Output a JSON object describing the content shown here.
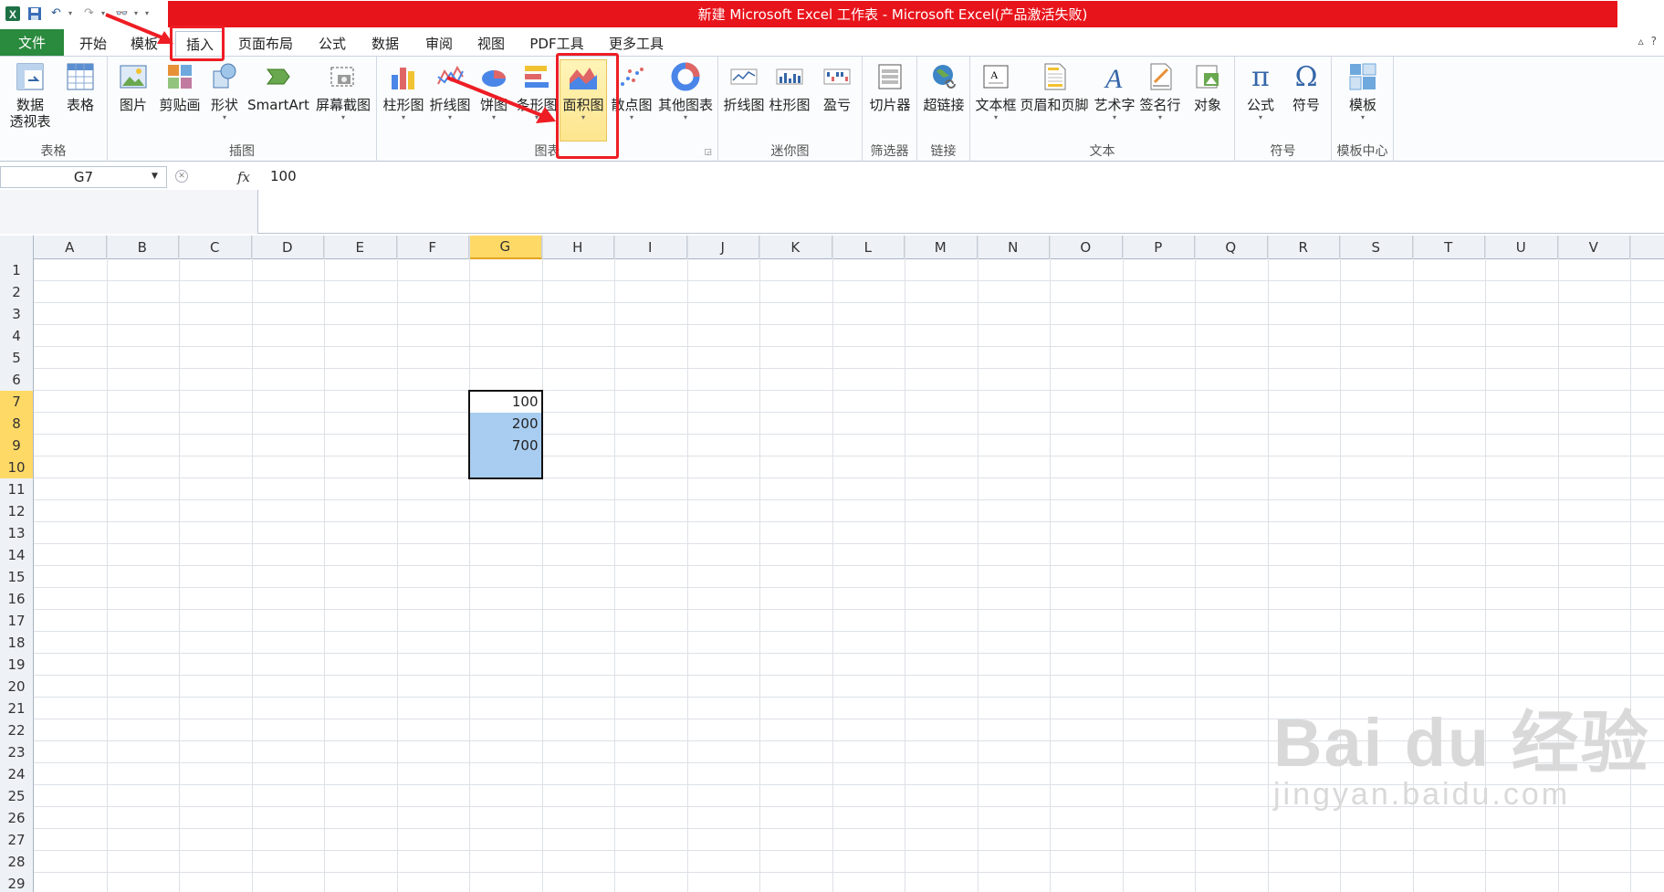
{
  "title": "新建 Microsoft Excel 工作表 - Microsoft Excel(产品激活失败)",
  "tabs": {
    "file": "文件",
    "start": "开始",
    "template": "模板",
    "insert": "插入",
    "layout": "页面布局",
    "formula": "公式",
    "data": "数据",
    "review": "审阅",
    "view": "视图",
    "pdf": "PDF工具",
    "more": "更多工具"
  },
  "ribbon": {
    "table_group": {
      "label": "表格",
      "pivot_line1": "数据",
      "pivot_line2": "透视表",
      "table": "表格"
    },
    "illustration_group": {
      "label": "插图",
      "picture": "图片",
      "clipart": "剪贴画",
      "shapes": "形状",
      "smartart": "SmartArt",
      "screenshot": "屏幕截图"
    },
    "chart_group": {
      "label": "图表",
      "column": "柱形图",
      "line": "折线图",
      "pie": "饼图",
      "bar": "条形图",
      "area": "面积图",
      "scatter": "散点图",
      "other": "其他图表"
    },
    "sparkline_group": {
      "label": "迷你图",
      "line": "折线图",
      "column": "柱形图",
      "winloss": "盈亏"
    },
    "filter_group": {
      "label": "筛选器",
      "slicer": "切片器"
    },
    "link_group": {
      "label": "链接",
      "hyperlink": "超链接"
    },
    "text_group": {
      "label": "文本",
      "textbox": "文本框",
      "headerfooter": "页眉和页脚",
      "wordart": "艺术字",
      "signature": "签名行",
      "object": "对象"
    },
    "symbol_group": {
      "label": "符号",
      "equation": "公式",
      "symbol": "符号"
    },
    "template_group": {
      "label": "模板中心",
      "template": "模板"
    }
  },
  "formula_bar": {
    "name_box": "G7",
    "fx": "fx",
    "value": "100"
  },
  "columns": [
    "A",
    "B",
    "C",
    "D",
    "E",
    "F",
    "G",
    "H",
    "I",
    "J",
    "K",
    "L",
    "M",
    "N",
    "O",
    "P",
    "Q",
    "R",
    "S",
    "T",
    "U",
    "V"
  ],
  "rows": [
    "1",
    "2",
    "3",
    "4",
    "5",
    "6",
    "7",
    "8",
    "9",
    "10",
    "11",
    "12",
    "13",
    "14",
    "15",
    "16",
    "17",
    "18",
    "19",
    "20",
    "21",
    "22",
    "23",
    "24",
    "25",
    "26",
    "27",
    "28",
    "29"
  ],
  "cells": {
    "G7": "100",
    "G8": "200",
    "G9": "700"
  },
  "selected_column": "G",
  "selected_rows": [
    "7",
    "8",
    "9",
    "10"
  ],
  "colors": {
    "accent_red": "#e8141b",
    "file_tab": "#2a8a3e",
    "selection": "#a8cdf0",
    "header_highlight": "#ffd966"
  },
  "watermark": {
    "main": "Bai du 经验",
    "sub": "jingyan.baidu.com"
  }
}
